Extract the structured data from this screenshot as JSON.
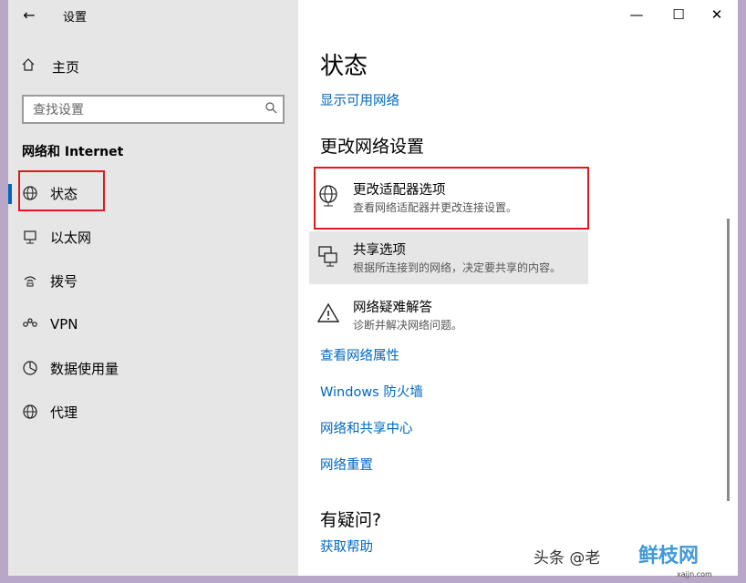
{
  "window": {
    "title": "设置"
  },
  "nav": {
    "home": "主页",
    "search_placeholder": "查找设置",
    "section": "网络和 Internet",
    "items": [
      {
        "label": "状态",
        "icon": "globe-icon"
      },
      {
        "label": "以太网",
        "icon": "ethernet-icon"
      },
      {
        "label": "拨号",
        "icon": "dialup-icon"
      },
      {
        "label": "VPN",
        "icon": "vpn-icon"
      },
      {
        "label": "数据使用量",
        "icon": "data-usage-icon"
      },
      {
        "label": "代理",
        "icon": "proxy-globe-icon"
      }
    ]
  },
  "main": {
    "title": "状态",
    "show_networks": "显示可用网络",
    "change_heading": "更改网络设置",
    "cards": [
      {
        "title": "更改适配器选项",
        "desc": "查看网络适配器并更改连接设置。"
      },
      {
        "title": "共享选项",
        "desc": "根据所连接到的网络，决定要共享的内容。"
      },
      {
        "title": "网络疑难解答",
        "desc": "诊断并解决网络问题。"
      }
    ],
    "links": [
      "查看网络属性",
      "Windows 防火墙",
      "网络和共享中心",
      "网络重置"
    ],
    "question_heading": "有疑问?",
    "help_link": "获取帮助"
  },
  "watermark": {
    "text": "头条 @老",
    "brand": "鲜枝网",
    "url": "xajjn.com"
  },
  "colors": {
    "accent": "#0067c0",
    "highlight_box": "#e0191e",
    "nav_bg": "#e6e6e6"
  }
}
